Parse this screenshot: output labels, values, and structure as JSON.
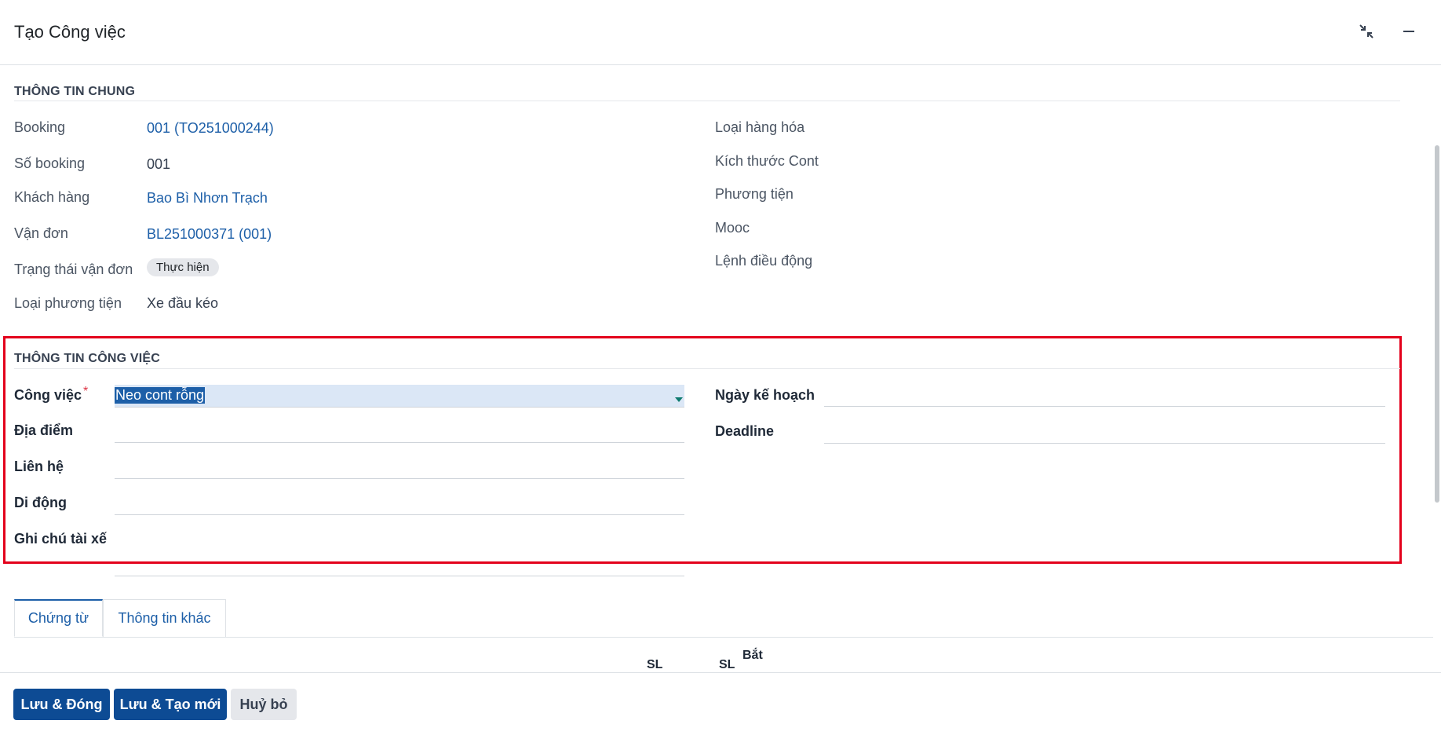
{
  "dialog": {
    "title": "Tạo Công việc"
  },
  "general": {
    "section_title": "THÔNG TIN CHUNG",
    "left": [
      {
        "label": "Booking",
        "value": "001 (TO251000244)",
        "kind": "link"
      },
      {
        "label": "Số booking",
        "value": "001",
        "kind": "text"
      },
      {
        "label": "Khách hàng",
        "value": "Bao Bì Nhơn Trạch",
        "kind": "link"
      },
      {
        "label": "Vận đơn",
        "value": "BL251000371 (001)",
        "kind": "link"
      },
      {
        "label": "Trạng thái vận đơn",
        "value": "Thực hiện",
        "kind": "badge"
      },
      {
        "label": "Loại phương tiện",
        "value": "Xe đầu kéo",
        "kind": "text"
      }
    ],
    "right": [
      {
        "label": "Loại hàng hóa"
      },
      {
        "label": "Kích thước Cont"
      },
      {
        "label": "Phương tiện"
      },
      {
        "label": "Mooc"
      },
      {
        "label": "Lệnh điều động"
      }
    ]
  },
  "job": {
    "section_title": "THÔNG TIN CÔNG VIỆC",
    "cong_viec_label": "Công việc",
    "required_mark": "*",
    "cong_viec_value": "Neo cont rỗng",
    "dia_diem_label": "Địa điểm",
    "lien_he_label": "Liên hệ",
    "di_dong_label": "Di động",
    "ghi_chu_label": "Ghi chú tài xế",
    "ngay_ke_hoach_label": "Ngày kế hoạch",
    "deadline_label": "Deadline"
  },
  "tabs": [
    {
      "label": "Chứng từ",
      "active": true
    },
    {
      "label": "Thông tin khác",
      "active": false
    }
  ],
  "table_partial_headers": {
    "col1": "SL",
    "col2": "SL",
    "col3": "Bắt"
  },
  "footer": {
    "save_close": "Lưu & Đóng",
    "save_new": "Lưu & Tạo mới",
    "cancel": "Huỷ bỏ"
  },
  "colors": {
    "primary": "#0d4b94",
    "link": "#1d5fa8",
    "highlight_border": "#e3001b",
    "selection_bg": "#dbe7f6"
  },
  "icons": {
    "restore": "compress-arrows-icon",
    "minimize": "minimize-icon",
    "dropdown": "caret-down-icon"
  }
}
